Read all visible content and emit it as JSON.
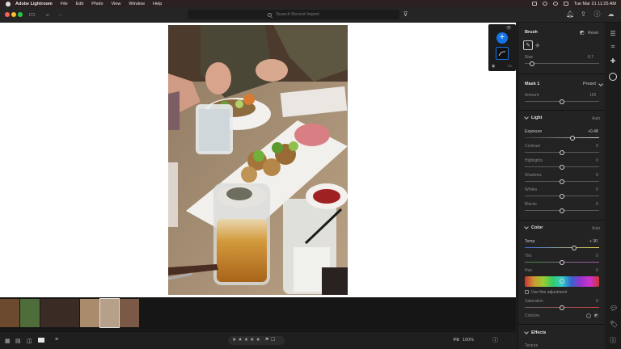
{
  "menubar": {
    "app_name": "Adobe Lightroom",
    "items": [
      "File",
      "Edit",
      "Photo",
      "View",
      "Window",
      "Help"
    ],
    "datetime": "Tue Mar 21  11:25 AM"
  },
  "toolbar": {
    "search_placeholder": "Search Recent Import"
  },
  "brush_panel": {
    "title": "Brush",
    "reset_label": "Reset",
    "size_label": "Size",
    "size_value": "5.7",
    "size_level": 0.1
  },
  "mask": {
    "name": "Mask 1",
    "preset_label": "Preset",
    "amount_label": "Amount",
    "amount_value": "100",
    "amount_level": 0.5
  },
  "light": {
    "title": "Light",
    "auto_label": "Auto",
    "sliders": [
      {
        "label": "Exposure",
        "value": "+0.48",
        "level": 0.64
      },
      {
        "label": "Contrast",
        "value": "0",
        "level": 0.5
      },
      {
        "label": "Highlights",
        "value": "0",
        "level": 0.5
      },
      {
        "label": "Shadows",
        "value": "0",
        "level": 0.5
      },
      {
        "label": "Whites",
        "value": "0",
        "level": 0.5
      },
      {
        "label": "Blacks",
        "value": "0",
        "level": 0.5
      }
    ]
  },
  "color": {
    "title": "Color",
    "auto_label": "Auto",
    "temp_label": "Temp",
    "temp_value": "+ 30",
    "temp_level": 0.66,
    "tint_label": "Tint",
    "tint_value": "0",
    "tint_level": 0.5,
    "hue_label": "Hue",
    "hue_value": "0",
    "hue_level": 0.5,
    "fine_adjust_label": "Use fine adjustment",
    "saturation_label": "Saturation",
    "saturation_value": "0",
    "saturation_level": 0.5,
    "colorize_label": "Colorize"
  },
  "effects": {
    "title": "Effects",
    "texture_label": "Texture"
  },
  "bottombar": {
    "fit_label": "Fit",
    "zoom_value": "100%",
    "rating_stars": 5
  },
  "filmstrip": {
    "thumbnails": [
      "bowls",
      "salad",
      "wraps",
      "table-top",
      "spread",
      "plates",
      "drinks"
    ]
  }
}
